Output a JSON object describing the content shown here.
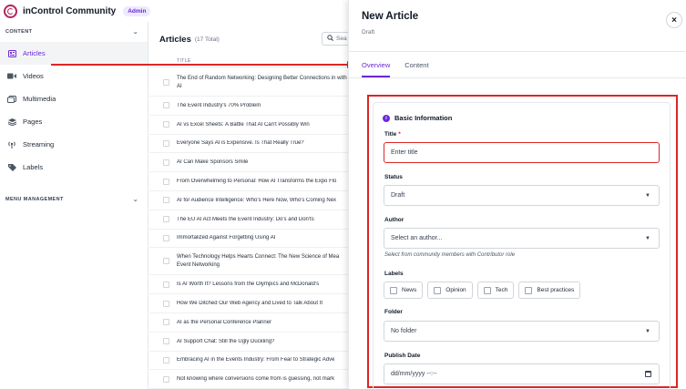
{
  "app": {
    "name": "inControl Community",
    "badge": "Admin"
  },
  "sidebar": {
    "content_heading": "CONTENT",
    "menu_heading": "MENU MANAGEMENT",
    "items": [
      {
        "label": "Articles",
        "icon": "articles-icon",
        "active": true
      },
      {
        "label": "Videos",
        "icon": "video-icon",
        "active": false
      },
      {
        "label": "Multimedia",
        "icon": "multimedia-icon",
        "active": false
      },
      {
        "label": "Pages",
        "icon": "pages-icon",
        "active": false
      },
      {
        "label": "Streaming",
        "icon": "streaming-icon",
        "active": false
      },
      {
        "label": "Labels",
        "icon": "label-icon",
        "active": false
      }
    ]
  },
  "main": {
    "title": "Articles",
    "count": "(17 Total)",
    "search_placeholder": "Sea",
    "column_title": "TITLE",
    "rows": [
      "The End of Random Networking: Designing Better Connections in with AI",
      "The Event Industry's 70% Problem",
      "AI vs Excel Sheets: A Battle That AI Can't Possibly Win",
      "Everyone Says AI is Expensive. Is That Really True?",
      "AI Can Make Sponsors Smile",
      "From Overwhelming to Personal: How AI Transforms the Expo Flo",
      "AI for Audience Intelligence: Who's Here Now, Who's Coming Nex",
      "The EU AI Act Meets the Event Industry: Do's and Don'ts",
      "Immortalized Against Forgetting Using AI",
      "When Technology Helps Hearts Connect: The New Science of Mea Event Networking",
      "Is AI Worth It? Lessons from the Olympics and McDonald's",
      "How We Ditched Our Web Agency and Lived to Talk About It",
      "AI as the Personal Conference Planner",
      "AI Support Chat: Still the Ugly Duckling?",
      "Embracing AI in the Events Industry: From Fear to Strategic Adve",
      "Not knowing where conversions come from is guessing, not mark"
    ]
  },
  "panel": {
    "title": "New Article",
    "subtitle": "Draft",
    "close_label": "×",
    "tabs": [
      "Overview",
      "Content"
    ],
    "section_title": "Basic Information",
    "title_label": "Title",
    "title_required": "*",
    "title_placeholder": "Enter title",
    "status_label": "Status",
    "status_value": "Draft",
    "author_label": "Author",
    "author_value": "Select an author...",
    "author_hint": "Select from community members with Contributor role",
    "labels_label": "Labels",
    "label_options": [
      "News",
      "Opinion",
      "Tech",
      "Best practices"
    ],
    "folder_label": "Folder",
    "folder_value": "No folder",
    "publish_label": "Publish Date",
    "publish_value": "dd/mm/yyyy --:--"
  },
  "colors": {
    "accent": "#6d28d9",
    "annotation": "#dc2626"
  }
}
